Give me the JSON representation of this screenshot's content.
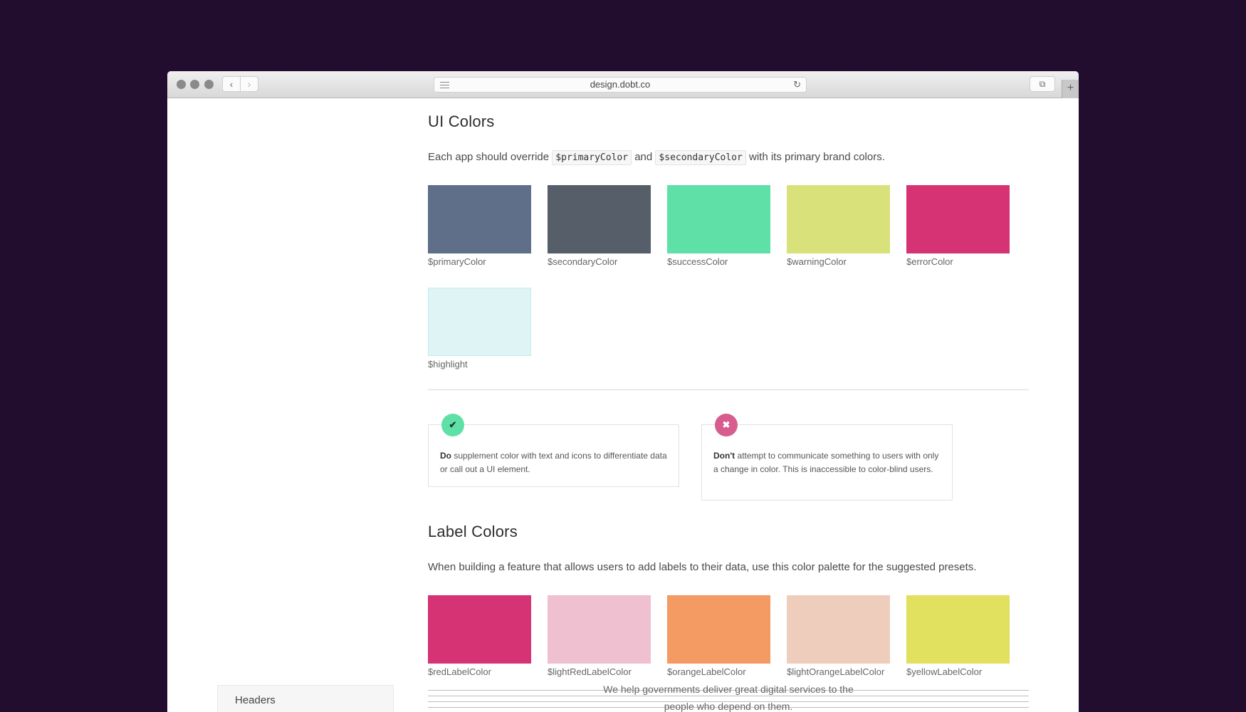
{
  "browser": {
    "url": "design.dobt.co",
    "back_glyph": "‹",
    "forward_glyph": "›",
    "reload_glyph": "↻",
    "tabs_glyph": "⧉",
    "newtab_glyph": "+"
  },
  "ui_colors": {
    "title": "UI Colors",
    "intro_before": "Each app should override",
    "code1": "$primaryColor",
    "intro_and": "and",
    "code2": "$secondaryColor",
    "intro_after": "with its primary brand colors.",
    "swatches": [
      {
        "name": "$primaryColor",
        "color": "#5f6f8a"
      },
      {
        "name": "$secondaryColor",
        "color": "#565f69"
      },
      {
        "name": "$successColor",
        "color": "#5ee0a6"
      },
      {
        "name": "$warningColor",
        "color": "#d9e27a"
      },
      {
        "name": "$errorColor",
        "color": "#d63374"
      },
      {
        "name": "$highlight",
        "color": "#dff4f4"
      }
    ]
  },
  "guidance": {
    "do_icon": "✔",
    "do_strong": "Do",
    "do_text": "supplement color with text and icons to differentiate data or call out a UI element.",
    "dont_icon": "✖",
    "dont_strong": "Don't",
    "dont_text": "attempt to communicate something to users with only a change in color. This is inaccessible to color-blind users."
  },
  "label_colors": {
    "title": "Label Colors",
    "intro": "When building a feature that allows users to add labels to their data, use this color palette for the suggested presets.",
    "swatches": [
      {
        "name": "$redLabelColor",
        "color": "#d63374"
      },
      {
        "name": "$lightRedLabelColor",
        "color": "#efc0d0"
      },
      {
        "name": "$orangeLabelColor",
        "color": "#f49a63"
      },
      {
        "name": "$lightOrangeLabelColor",
        "color": "#efcdbc"
      },
      {
        "name": "$yellowLabelColor",
        "color": "#e2e05f"
      }
    ]
  },
  "footer": {
    "line1": "We help governments deliver great digital services to the",
    "line2": "people who depend on them."
  },
  "sidebar": {
    "item_label": "Headers"
  }
}
